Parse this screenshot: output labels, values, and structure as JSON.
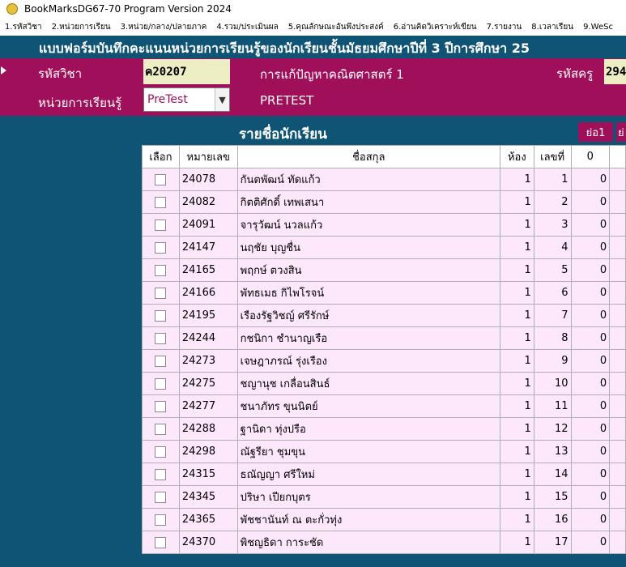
{
  "window": {
    "title": "BookMarksDG67-70 Program Version 2024"
  },
  "menu": [
    "1.รหัสวิชา",
    "2.หน่วยการเรียน",
    "3.หน่วย/กลาง/ปลายภาค",
    "4.รวม/ประเมินผล",
    "5.คุณลักษณะอันพึงประสงค์",
    "6.อ่านคิดวิเคราะห์เขียน",
    "7.รายงาน",
    "8.เวลาเรียน",
    "9.WeSc"
  ],
  "form": {
    "title": "แบบฟอร์มบันทึกคะแนนหน่วยการเรียนรู้ของนักเรียนชั้นมัธยมศึกษาปีที่ 3   ปีการศึกษา 25"
  },
  "header": {
    "subject_code_label": "รหัสวิชา",
    "subject_code": "ค20207",
    "subject_name": "การแก้ปัญหาคณิตศาสตร์ 1",
    "teacher_code_label": "รหัสครู",
    "teacher_code": "294",
    "unit_label": "หน่วยการเรียนรู้",
    "unit_value": "PreTest",
    "unit_name": "PRETEST"
  },
  "list": {
    "title": "รายชื่อนักเรียน",
    "shrink1": "ย่อ1",
    "shrink2": "ย่",
    "columns": [
      "เลือก",
      "หมายเลข",
      "ชื่อสกุล",
      "ห้อง",
      "เลขที่",
      "0"
    ],
    "rows": [
      {
        "code": "24078",
        "name": "กันตพัฒน์  ทัดแก้ว",
        "room": "1",
        "num": "1",
        "score": "0"
      },
      {
        "code": "24082",
        "name": "กิตติศักดิ์  เทพเสนา",
        "room": "1",
        "num": "2",
        "score": "0"
      },
      {
        "code": "24091",
        "name": "จารุวัฒน์  นวลแก้ว",
        "room": "1",
        "num": "3",
        "score": "0"
      },
      {
        "code": "24147",
        "name": "นฤชัย  บุญชื่น",
        "room": "1",
        "num": "4",
        "score": "0"
      },
      {
        "code": "24165",
        "name": "พฤกษ์  ตวงสิน",
        "room": "1",
        "num": "5",
        "score": "0"
      },
      {
        "code": "24166",
        "name": "พัทธเมธ  กิไพโรจน์",
        "room": "1",
        "num": "6",
        "score": "0"
      },
      {
        "code": "24195",
        "name": "เรืองรัฐวิชญ์  ศรีรักษ์",
        "room": "1",
        "num": "7",
        "score": "0"
      },
      {
        "code": "24244",
        "name": "กชนิกา  ชำนาญเรือ",
        "room": "1",
        "num": "8",
        "score": "0"
      },
      {
        "code": "24273",
        "name": "เจษฎาภรณ์  รุ่งเรือง",
        "room": "1",
        "num": "9",
        "score": "0"
      },
      {
        "code": "24275",
        "name": "ชญานุช  เกลื่อนสินธ์",
        "room": "1",
        "num": "10",
        "score": "0"
      },
      {
        "code": "24277",
        "name": "ชนาภัทร  ขุนนิตย์",
        "room": "1",
        "num": "11",
        "score": "0"
      },
      {
        "code": "24288",
        "name": "ฐานิดา  ทุ่งปรือ",
        "room": "1",
        "num": "12",
        "score": "0"
      },
      {
        "code": "24298",
        "name": "ณัฐรียา  ชุมขุน",
        "room": "1",
        "num": "13",
        "score": "0"
      },
      {
        "code": "24315",
        "name": "ธณัญญา  ศรีใหม่",
        "room": "1",
        "num": "14",
        "score": "0"
      },
      {
        "code": "24345",
        "name": "ปริษา  เปียกบุตร",
        "room": "1",
        "num": "15",
        "score": "0"
      },
      {
        "code": "24365",
        "name": "พัชชานันท์  ณ ตะกั่วทุ่ง",
        "room": "1",
        "num": "16",
        "score": "0"
      },
      {
        "code": "24370",
        "name": "พิชญธิดา  การะชัด",
        "room": "1",
        "num": "17",
        "score": "0"
      }
    ]
  }
}
